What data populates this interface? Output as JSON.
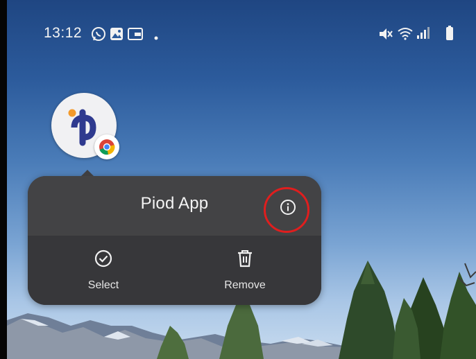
{
  "status_bar": {
    "time": "13:12",
    "icons": [
      "whatsapp-icon",
      "gallery-icon",
      "wallet-icon",
      "dot-icon",
      "mute-icon",
      "wifi-icon",
      "signal-icon",
      "battery-icon"
    ]
  },
  "app": {
    "icon": "piod-app-icon",
    "badge": "chrome-icon",
    "name": "Piod App"
  },
  "popup": {
    "title": "Piod App",
    "info_icon": "info-icon",
    "actions": [
      {
        "label": "Select",
        "icon": "check-circle-icon"
      },
      {
        "label": "Remove",
        "icon": "trash-icon"
      }
    ]
  },
  "colors": {
    "highlight": "#e01e1e",
    "popup_bg": "#3f3f41",
    "brand": "#2f3a8f",
    "accent": "#f39a2b"
  }
}
